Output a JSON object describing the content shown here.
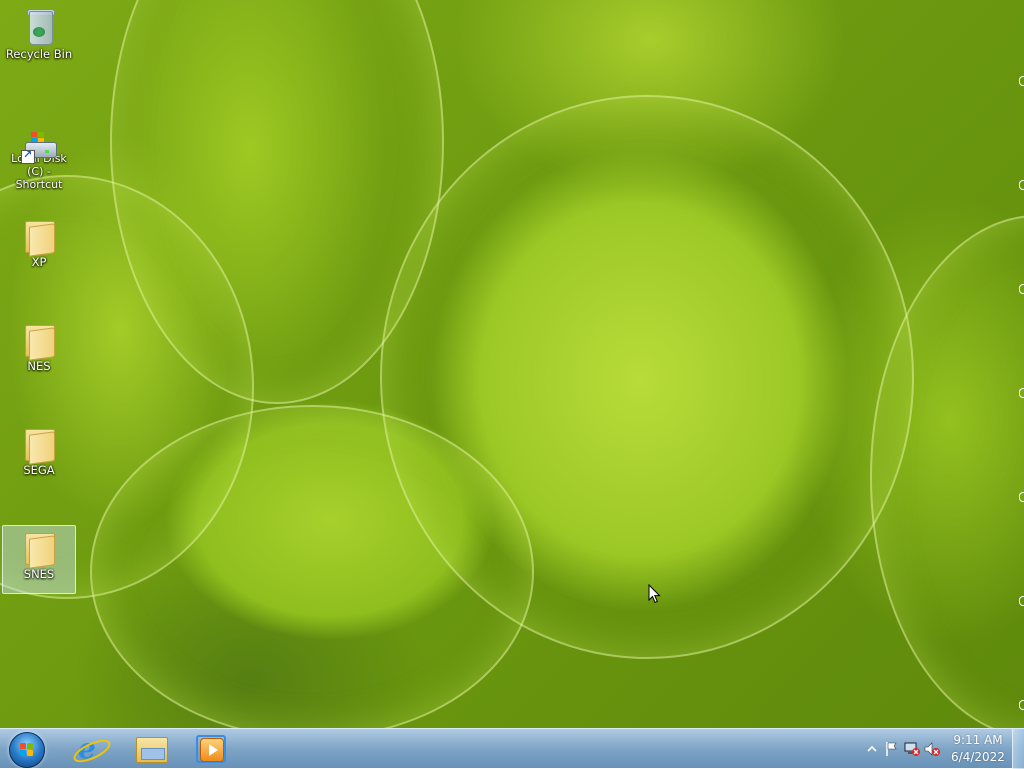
{
  "desktop": {
    "icons": [
      {
        "label": "Recycle Bin",
        "icon": "recycle-bin-icon"
      },
      {
        "label": "Local Disk (C) - Shortcut",
        "icon": "drive-shortcut-icon"
      },
      {
        "label": "XP",
        "icon": "folder-icon"
      },
      {
        "label": "NES",
        "icon": "folder-icon"
      },
      {
        "label": "SEGA",
        "icon": "folder-icon"
      },
      {
        "label": "SNES",
        "icon": "folder-icon",
        "selected": true
      }
    ],
    "wallpaper": "green succulent leaves",
    "colors": {
      "wallpaper_primary": "#9cc825",
      "wallpaper_dark": "#5f8a0c"
    }
  },
  "taskbar": {
    "start_icon": "windows-orb-icon",
    "pinned": [
      {
        "name": "Internet Explorer",
        "icon": "internet-explorer-icon"
      },
      {
        "name": "Windows Explorer",
        "icon": "file-explorer-icon"
      },
      {
        "name": "Windows Media Player",
        "icon": "media-player-icon"
      }
    ],
    "tray": {
      "icons": [
        "show-hidden-icons-icon",
        "action-center-flag-icon",
        "network-disconnected-icon",
        "volume-muted-icon"
      ],
      "time": "9:11 AM",
      "date": "6/4/2022"
    }
  }
}
